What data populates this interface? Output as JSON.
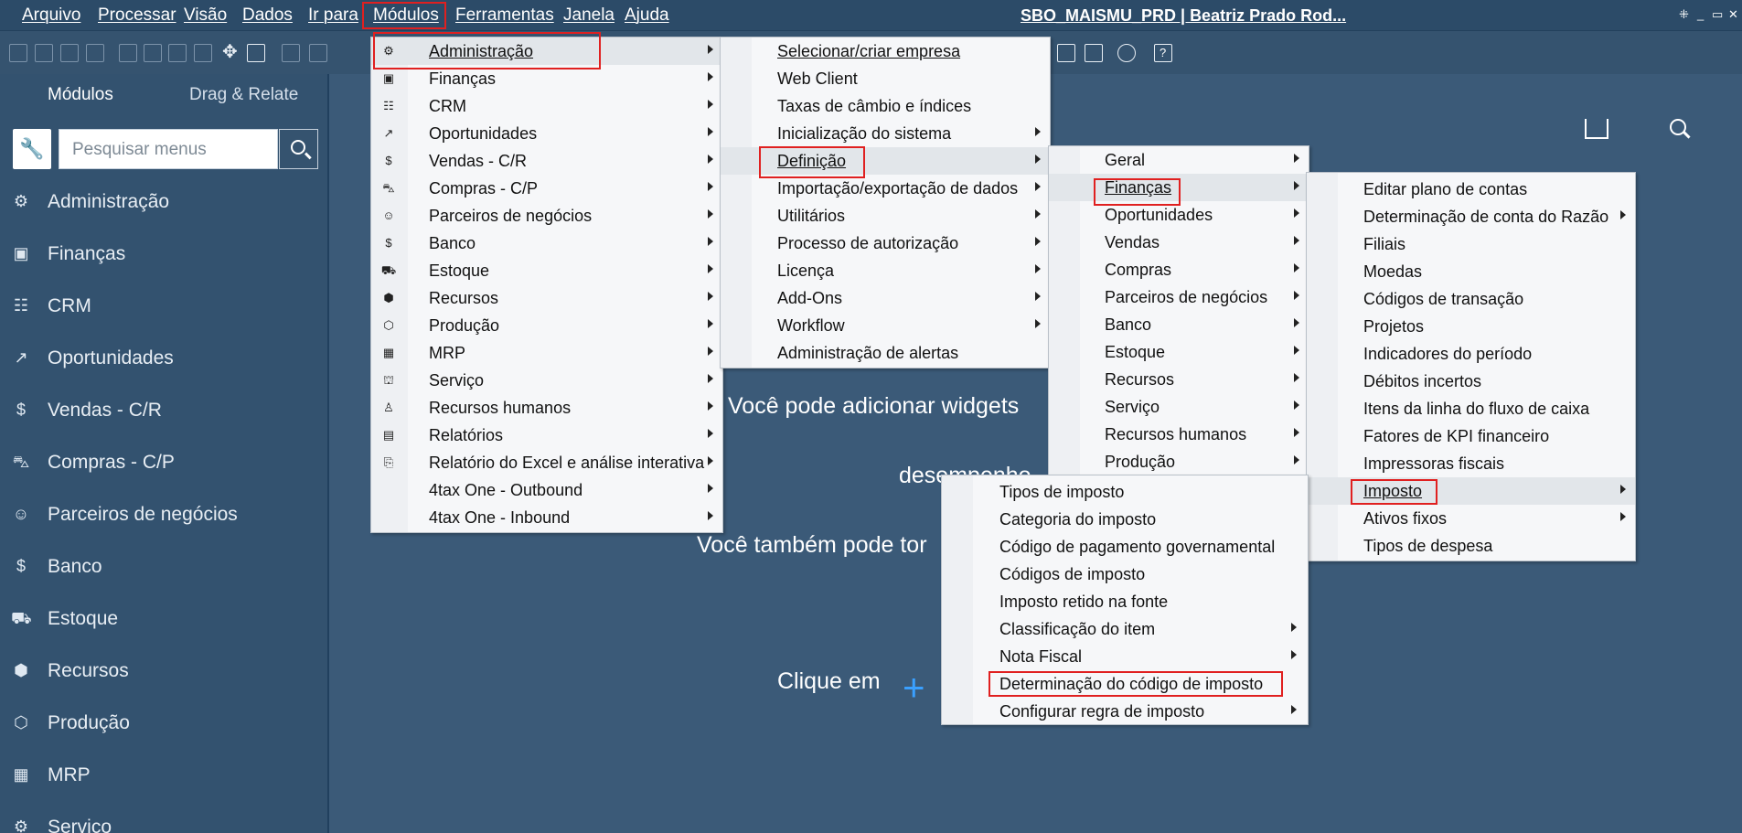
{
  "menubar": {
    "items": [
      "Arquivo",
      "Processar",
      "Visão",
      "Dados",
      "Ir para",
      "Módulos",
      "Ferramentas",
      "Janela",
      "Ajuda"
    ],
    "window_title": "SBO_MAISMU_PRD | Beatriz Prado Rod..."
  },
  "sidebar": {
    "tabs": [
      "Módulos",
      "Drag & Relate"
    ],
    "search_placeholder": "Pesquisar menus",
    "items": [
      {
        "label": "Administração",
        "icon": "gear-icon"
      },
      {
        "label": "Finanças",
        "icon": "finance-icon"
      },
      {
        "label": "CRM",
        "icon": "crm-icon"
      },
      {
        "label": "Oportunidades",
        "icon": "chart-icon"
      },
      {
        "label": "Vendas - C/R",
        "icon": "dollar-icon"
      },
      {
        "label": "Compras - C/P",
        "icon": "cart-icon"
      },
      {
        "label": "Parceiros de negócios",
        "icon": "partners-icon"
      },
      {
        "label": "Banco",
        "icon": "bank-icon"
      },
      {
        "label": "Estoque",
        "icon": "stock-icon"
      },
      {
        "label": "Recursos",
        "icon": "resources-icon"
      },
      {
        "label": "Produção",
        "icon": "production-icon"
      },
      {
        "label": "MRP",
        "icon": "calendar-icon"
      },
      {
        "label": "Serviço",
        "icon": "service-icon"
      }
    ]
  },
  "main": {
    "line1": "Você pode adicionar widgets",
    "line2": "desempenho",
    "line3": "Você também pode tor",
    "line4": "Clique em"
  },
  "menus": {
    "modulos": [
      {
        "label": "Administração",
        "icon": "gear-icon",
        "arrow": true
      },
      {
        "label": "Finanças",
        "icon": "finance-icon",
        "arrow": true
      },
      {
        "label": "CRM",
        "icon": "crm-icon",
        "arrow": true
      },
      {
        "label": "Oportunidades",
        "icon": "chart-icon",
        "arrow": true
      },
      {
        "label": "Vendas - C/R",
        "icon": "dollar-icon",
        "arrow": true
      },
      {
        "label": "Compras - C/P",
        "icon": "cart-icon",
        "arrow": true
      },
      {
        "label": "Parceiros de negócios",
        "icon": "partners-icon",
        "arrow": true
      },
      {
        "label": "Banco",
        "icon": "bank-icon",
        "arrow": true
      },
      {
        "label": "Estoque",
        "icon": "stock-icon",
        "arrow": true
      },
      {
        "label": "Recursos",
        "icon": "resources-icon",
        "arrow": true
      },
      {
        "label": "Produção",
        "icon": "production-icon",
        "arrow": true
      },
      {
        "label": "MRP",
        "icon": "calendar-icon",
        "arrow": true
      },
      {
        "label": "Serviço",
        "icon": "service-icon",
        "arrow": true
      },
      {
        "label": "Recursos humanos",
        "icon": "person-icon",
        "arrow": true
      },
      {
        "label": "Relatórios",
        "icon": "report-icon",
        "arrow": true
      },
      {
        "label": "Relatório do Excel e análise interativa",
        "icon": "excel-icon",
        "arrow": true
      },
      {
        "label": "4tax One - Outbound",
        "icon": "",
        "arrow": true
      },
      {
        "label": "4tax One - Inbound",
        "icon": "",
        "arrow": true
      }
    ],
    "administracao": [
      {
        "label": "Selecionar/criar empresa",
        "arrow": false
      },
      {
        "label": "Web Client",
        "arrow": false
      },
      {
        "label": "Taxas de câmbio e índices",
        "arrow": false
      },
      {
        "label": "Inicialização do sistema",
        "arrow": true
      },
      {
        "label": "Definição",
        "arrow": true
      },
      {
        "label": "Importação/exportação de dados",
        "arrow": true
      },
      {
        "label": "Utilitários",
        "arrow": true
      },
      {
        "label": "Processo de autorização",
        "arrow": true
      },
      {
        "label": "Licença",
        "arrow": true
      },
      {
        "label": "Add-Ons",
        "arrow": true
      },
      {
        "label": "Workflow",
        "arrow": true
      },
      {
        "label": "Administração de alertas",
        "arrow": false
      }
    ],
    "definicao": [
      {
        "label": "Geral",
        "arrow": true
      },
      {
        "label": "Finanças",
        "arrow": true
      },
      {
        "label": "Oportunidades",
        "arrow": true
      },
      {
        "label": "Vendas",
        "arrow": true
      },
      {
        "label": "Compras",
        "arrow": true
      },
      {
        "label": "Parceiros de negócios",
        "arrow": true
      },
      {
        "label": "Banco",
        "arrow": true
      },
      {
        "label": "Estoque",
        "arrow": true
      },
      {
        "label": "Recursos",
        "arrow": true
      },
      {
        "label": "Serviço",
        "arrow": true
      },
      {
        "label": "Recursos humanos",
        "arrow": true
      },
      {
        "label": "Produção",
        "arrow": true
      }
    ],
    "financas": [
      {
        "label": "Editar plano de contas",
        "arrow": false
      },
      {
        "label": "Determinação de conta do Razão",
        "arrow": true
      },
      {
        "label": "Filiais",
        "arrow": false
      },
      {
        "label": "Moedas",
        "arrow": false
      },
      {
        "label": "Códigos de transação",
        "arrow": false
      },
      {
        "label": "Projetos",
        "arrow": false
      },
      {
        "label": "Indicadores do período",
        "arrow": false
      },
      {
        "label": "Débitos incertos",
        "arrow": false
      },
      {
        "label": "Itens da linha do fluxo de caixa",
        "arrow": false
      },
      {
        "label": "Fatores de KPI financeiro",
        "arrow": false
      },
      {
        "label": "Impressoras fiscais",
        "arrow": false
      },
      {
        "label": "Imposto",
        "arrow": true
      },
      {
        "label": "Ativos fixos",
        "arrow": true
      },
      {
        "label": "Tipos de despesa",
        "arrow": false
      }
    ],
    "imposto": [
      {
        "label": "Tipos de imposto",
        "arrow": false
      },
      {
        "label": "Categoria do imposto",
        "arrow": false
      },
      {
        "label": "Código de pagamento governamental",
        "arrow": false
      },
      {
        "label": "Códigos de imposto",
        "arrow": false
      },
      {
        "label": "Imposto retido na fonte",
        "arrow": false
      },
      {
        "label": "Classificação do item",
        "arrow": true
      },
      {
        "label": "Nota Fiscal",
        "arrow": true
      },
      {
        "label": "Determinação do código de imposto",
        "arrow": false
      },
      {
        "label": "Configurar regra de imposto",
        "arrow": true
      }
    ]
  },
  "colors": {
    "background": "#3b5a78",
    "menubar": "#2c4b68",
    "highlight_box": "#e02020",
    "plus": "#3aa0ff"
  }
}
